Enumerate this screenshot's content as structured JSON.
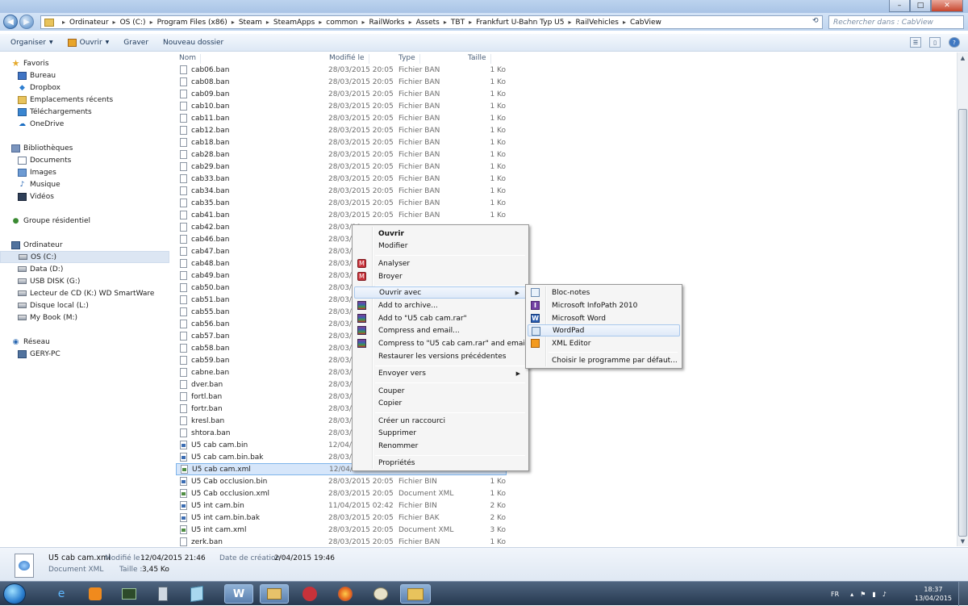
{
  "window": {
    "min": "–",
    "max": "□",
    "close": "✕"
  },
  "address": {
    "breadcrumbs": [
      "Ordinateur",
      "OS (C:)",
      "Program Files (x86)",
      "Steam",
      "SteamApps",
      "common",
      "RailWorks",
      "Assets",
      "TBT",
      "Frankfurt U-Bahn Typ U5",
      "RailVehicles",
      "CabView"
    ],
    "search_placeholder": "Rechercher dans : CabView"
  },
  "toolbar": {
    "organize": "Organiser",
    "open": "Ouvrir",
    "burn": "Graver",
    "new_folder": "Nouveau dossier"
  },
  "nav": {
    "favorites": "Favoris",
    "favorite_items": [
      "Bureau",
      "Dropbox",
      "Emplacements récents",
      "Téléchargements",
      "OneDrive"
    ],
    "libraries": "Bibliothèques",
    "library_items": [
      "Documents",
      "Images",
      "Musique",
      "Vidéos"
    ],
    "homegroup": "Groupe résidentiel",
    "computer": "Ordinateur",
    "computer_items": [
      "OS (C:)",
      "Data (D:)",
      "USB DISK (G:)",
      "Lecteur de CD (K:) WD SmartWare",
      "Disque local (L:)",
      "My Book (M:)"
    ],
    "network": "Réseau",
    "network_items": [
      "GERY-PC"
    ]
  },
  "columns": {
    "name": "Nom",
    "modified": "Modifié le",
    "type": "Type",
    "size": "Taille"
  },
  "files": [
    {
      "name": "cab06.ban",
      "date": "28/03/2015 20:05",
      "type": "Fichier BAN",
      "size": "1 Ko"
    },
    {
      "name": "cab08.ban",
      "date": "28/03/2015 20:05",
      "type": "Fichier BAN",
      "size": "1 Ko"
    },
    {
      "name": "cab09.ban",
      "date": "28/03/2015 20:05",
      "type": "Fichier BAN",
      "size": "1 Ko"
    },
    {
      "name": "cab10.ban",
      "date": "28/03/2015 20:05",
      "type": "Fichier BAN",
      "size": "1 Ko"
    },
    {
      "name": "cab11.ban",
      "date": "28/03/2015 20:05",
      "type": "Fichier BAN",
      "size": "1 Ko"
    },
    {
      "name": "cab12.ban",
      "date": "28/03/2015 20:05",
      "type": "Fichier BAN",
      "size": "1 Ko"
    },
    {
      "name": "cab18.ban",
      "date": "28/03/2015 20:05",
      "type": "Fichier BAN",
      "size": "1 Ko"
    },
    {
      "name": "cab28.ban",
      "date": "28/03/2015 20:05",
      "type": "Fichier BAN",
      "size": "1 Ko"
    },
    {
      "name": "cab29.ban",
      "date": "28/03/2015 20:05",
      "type": "Fichier BAN",
      "size": "1 Ko"
    },
    {
      "name": "cab33.ban",
      "date": "28/03/2015 20:05",
      "type": "Fichier BAN",
      "size": "1 Ko"
    },
    {
      "name": "cab34.ban",
      "date": "28/03/2015 20:05",
      "type": "Fichier BAN",
      "size": "1 Ko"
    },
    {
      "name": "cab35.ban",
      "date": "28/03/2015 20:05",
      "type": "Fichier BAN",
      "size": "1 Ko"
    },
    {
      "name": "cab41.ban",
      "date": "28/03/2015 20:05",
      "type": "Fichier BAN",
      "size": "1 Ko"
    },
    {
      "name": "cab42.ban",
      "date": "28/03/20",
      "type": "",
      "size": ""
    },
    {
      "name": "cab46.ban",
      "date": "28/03/20",
      "type": "",
      "size": ""
    },
    {
      "name": "cab47.ban",
      "date": "28/03/20",
      "type": "",
      "size": ""
    },
    {
      "name": "cab48.ban",
      "date": "28/03/20",
      "type": "",
      "size": ""
    },
    {
      "name": "cab49.ban",
      "date": "28/03/20",
      "type": "",
      "size": ""
    },
    {
      "name": "cab50.ban",
      "date": "28/03/20",
      "type": "",
      "size": ""
    },
    {
      "name": "cab51.ban",
      "date": "28/03/20",
      "type": "",
      "size": ""
    },
    {
      "name": "cab55.ban",
      "date": "28/03/20",
      "type": "",
      "size": ""
    },
    {
      "name": "cab56.ban",
      "date": "28/03/20",
      "type": "",
      "size": ""
    },
    {
      "name": "cab57.ban",
      "date": "28/03/20",
      "type": "",
      "size": ""
    },
    {
      "name": "cab58.ban",
      "date": "28/03/20",
      "type": "",
      "size": ""
    },
    {
      "name": "cab59.ban",
      "date": "28/03/20",
      "type": "",
      "size": ""
    },
    {
      "name": "cabne.ban",
      "date": "28/03/20",
      "type": "",
      "size": ""
    },
    {
      "name": "dver.ban",
      "date": "28/03/20",
      "type": "",
      "size": ""
    },
    {
      "name": "fortl.ban",
      "date": "28/03/20",
      "type": "",
      "size": ""
    },
    {
      "name": "fortr.ban",
      "date": "28/03/20",
      "type": "",
      "size": ""
    },
    {
      "name": "kresl.ban",
      "date": "28/03/20",
      "type": "",
      "size": ""
    },
    {
      "name": "shtora.ban",
      "date": "28/03/20",
      "type": "",
      "size": ""
    },
    {
      "name": "U5 cab cam.bin",
      "date": "12/04/20",
      "type": "",
      "size": ""
    },
    {
      "name": "U5 cab cam.bin.bak",
      "date": "28/03/20",
      "type": "",
      "size": ""
    },
    {
      "name": "U5 cab cam.xml",
      "date": "12/04/20",
      "type": "",
      "size": ""
    },
    {
      "name": "U5 Cab occlusion.bin",
      "date": "28/03/2015 20:05",
      "type": "Fichier BIN",
      "size": "1 Ko"
    },
    {
      "name": "U5 Cab occlusion.xml",
      "date": "28/03/2015 20:05",
      "type": "Document XML",
      "size": "1 Ko"
    },
    {
      "name": "U5 int cam.bin",
      "date": "11/04/2015 02:42",
      "type": "Fichier BIN",
      "size": "2 Ko"
    },
    {
      "name": "U5 int cam.bin.bak",
      "date": "28/03/2015 20:05",
      "type": "Fichier BAK",
      "size": "2 Ko"
    },
    {
      "name": "U5 int cam.xml",
      "date": "28/03/2015 20:05",
      "type": "Document XML",
      "size": "3 Ko"
    },
    {
      "name": "zerk.ban",
      "date": "28/03/2015 20:05",
      "type": "Fichier BAN",
      "size": "1 Ko"
    }
  ],
  "context_menu": {
    "open": "Ouvrir",
    "edit": "Modifier",
    "scan": "Analyser",
    "shred": "Broyer",
    "open_with": "Ouvrir avec",
    "add_archive": "Add to archive...",
    "add_rar": "Add to \"U5 cab cam.rar\"",
    "compress_email": "Compress and email...",
    "compress_rar_email": "Compress to \"U5 cab cam.rar\" and email",
    "restore": "Restaurer les versions précédentes",
    "send_to": "Envoyer vers",
    "cut": "Couper",
    "copy": "Copier",
    "shortcut": "Créer un raccourci",
    "delete": "Supprimer",
    "rename": "Renommer",
    "properties": "Propriétés"
  },
  "submenu": {
    "notepad": "Bloc-notes",
    "infopath": "Microsoft InfoPath 2010",
    "word": "Microsoft Word",
    "wordpad": "WordPad",
    "xmleditor": "XML Editor",
    "choose_default": "Choisir le programme par défaut..."
  },
  "details": {
    "name": "U5 cab cam.xml",
    "modified_label": "Modifié le :",
    "modified_value": "12/04/2015 21:46",
    "created_label": "Date de création :",
    "created_value": "2/04/2015 19:46",
    "type": "Document XML",
    "size_label": "Taille :",
    "size_value": "3,45 Ko"
  },
  "taskbar": {
    "lang": "FR",
    "time": "18:37",
    "date": "13/04/2015"
  }
}
